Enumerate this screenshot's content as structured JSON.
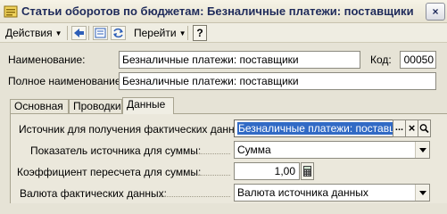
{
  "window": {
    "title": "Статьи оборотов по бюджетам: Безналичные платежи: поставщики",
    "close_glyph": "×"
  },
  "toolbar": {
    "actions_label": "Действия",
    "goto_label": "Перейти",
    "help_label": "?"
  },
  "form": {
    "name_label": "Наименование:",
    "name_value": "Безналичные платежи: поставщики",
    "code_label": "Код:",
    "code_value": "00050",
    "full_name_label": "Полное наименование:",
    "full_name_value": "Безналичные платежи: поставщики"
  },
  "tabs": [
    {
      "label": "Основная"
    },
    {
      "label": "Проводки"
    },
    {
      "label": "Данные"
    }
  ],
  "data_tab": {
    "source_label": "Источник для получения фактических данных:",
    "source_value": "Безналичные платежи: поставщи",
    "source_btn_dots": "...",
    "source_btn_clear": "×",
    "indicator_label": "Показатель источника для суммы:",
    "indicator_value": "Сумма",
    "coef_label": "Коэффициент пересчета для суммы:",
    "coef_value": "1,00",
    "currency_label": "Валюта фактических данных:",
    "currency_value": "Валюта источника данных"
  }
}
